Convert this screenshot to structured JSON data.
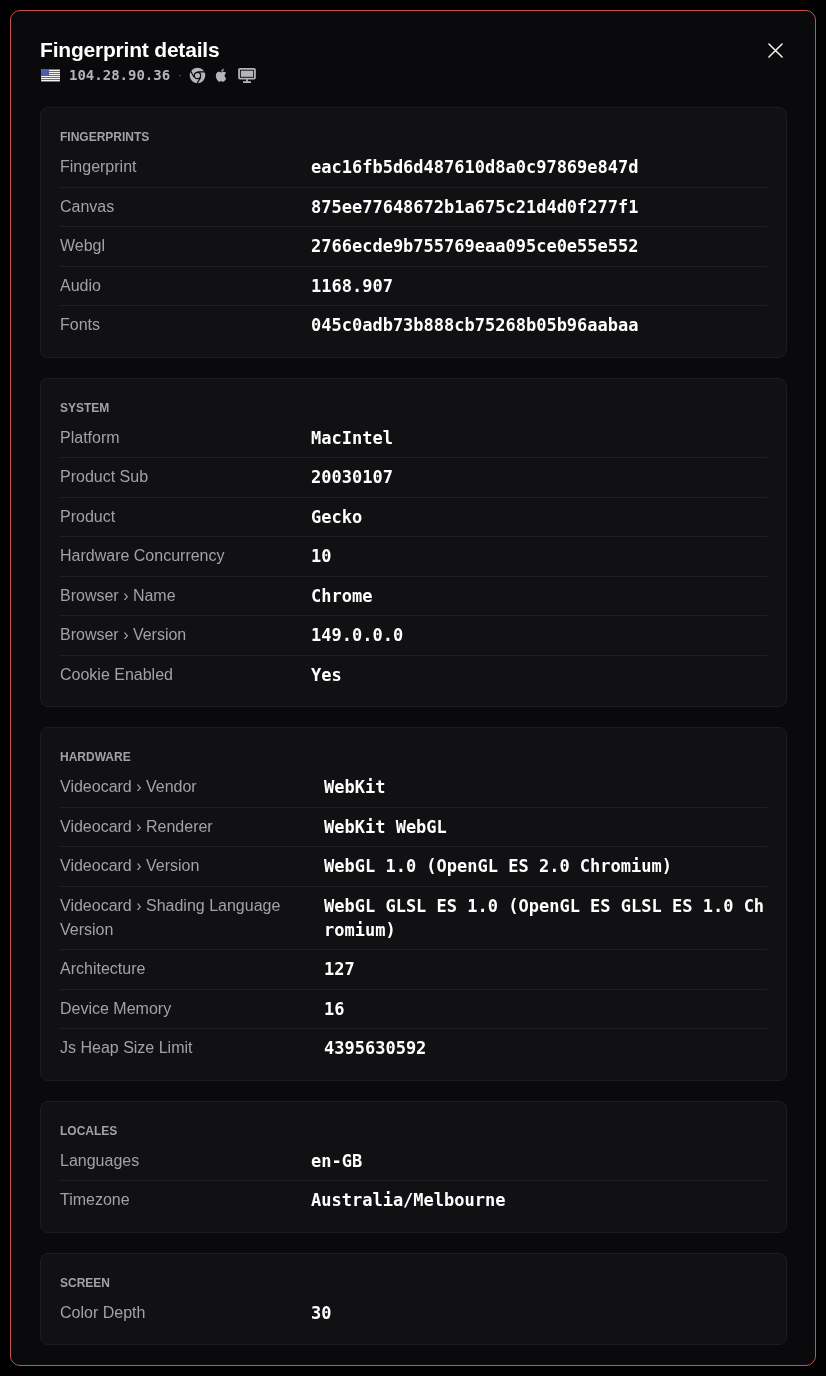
{
  "dialog": {
    "title": "Fingerprint details",
    "ip": "104.28.90.36",
    "separator": "·"
  },
  "sections": [
    {
      "title": "FINGERPRINTS",
      "rows": [
        {
          "label": "Fingerprint",
          "value": "eac16fb5d6d487610d8a0c97869e847d"
        },
        {
          "label": "Canvas",
          "value": "875ee77648672b1a675c21d4d0f277f1"
        },
        {
          "label": "Webgl",
          "value": "2766ecde9b755769eaa095ce0e55e552"
        },
        {
          "label": "Audio",
          "value": "1168.907"
        },
        {
          "label": "Fonts",
          "value": "045c0adb73b888cb75268b05b96aabaa"
        }
      ]
    },
    {
      "title": "SYSTEM",
      "rows": [
        {
          "label": "Platform",
          "value": "MacIntel"
        },
        {
          "label": "Product Sub",
          "value": "20030107"
        },
        {
          "label": "Product",
          "value": "Gecko"
        },
        {
          "label": "Hardware Concurrency",
          "value": "10"
        },
        {
          "label": "Browser › Name",
          "value": "Chrome"
        },
        {
          "label": "Browser › Version",
          "value": "149.0.0.0"
        },
        {
          "label": "Cookie Enabled",
          "value": "Yes"
        }
      ]
    },
    {
      "title": "HARDWARE",
      "rows": [
        {
          "label": "Videocard › Vendor",
          "value": "WebKit"
        },
        {
          "label": "Videocard › Renderer",
          "value": "WebKit WebGL"
        },
        {
          "label": "Videocard › Version",
          "value": "WebGL 1.0 (OpenGL ES 2.0 Chromium)"
        },
        {
          "label": "Videocard › Shading Language Version",
          "value": "WebGL GLSL ES 1.0 (OpenGL ES GLSL ES 1.0 Chromium)"
        },
        {
          "label": "Architecture",
          "value": "127"
        },
        {
          "label": "Device Memory",
          "value": "16"
        },
        {
          "label": "Js Heap Size Limit",
          "value": "4395630592"
        }
      ]
    },
    {
      "title": "LOCALES",
      "rows": [
        {
          "label": "Languages",
          "value": "en-GB"
        },
        {
          "label": "Timezone",
          "value": "Australia/Melbourne"
        }
      ]
    },
    {
      "title": "SCREEN",
      "rows": [
        {
          "label": "Color Depth",
          "value": "30"
        }
      ]
    }
  ]
}
